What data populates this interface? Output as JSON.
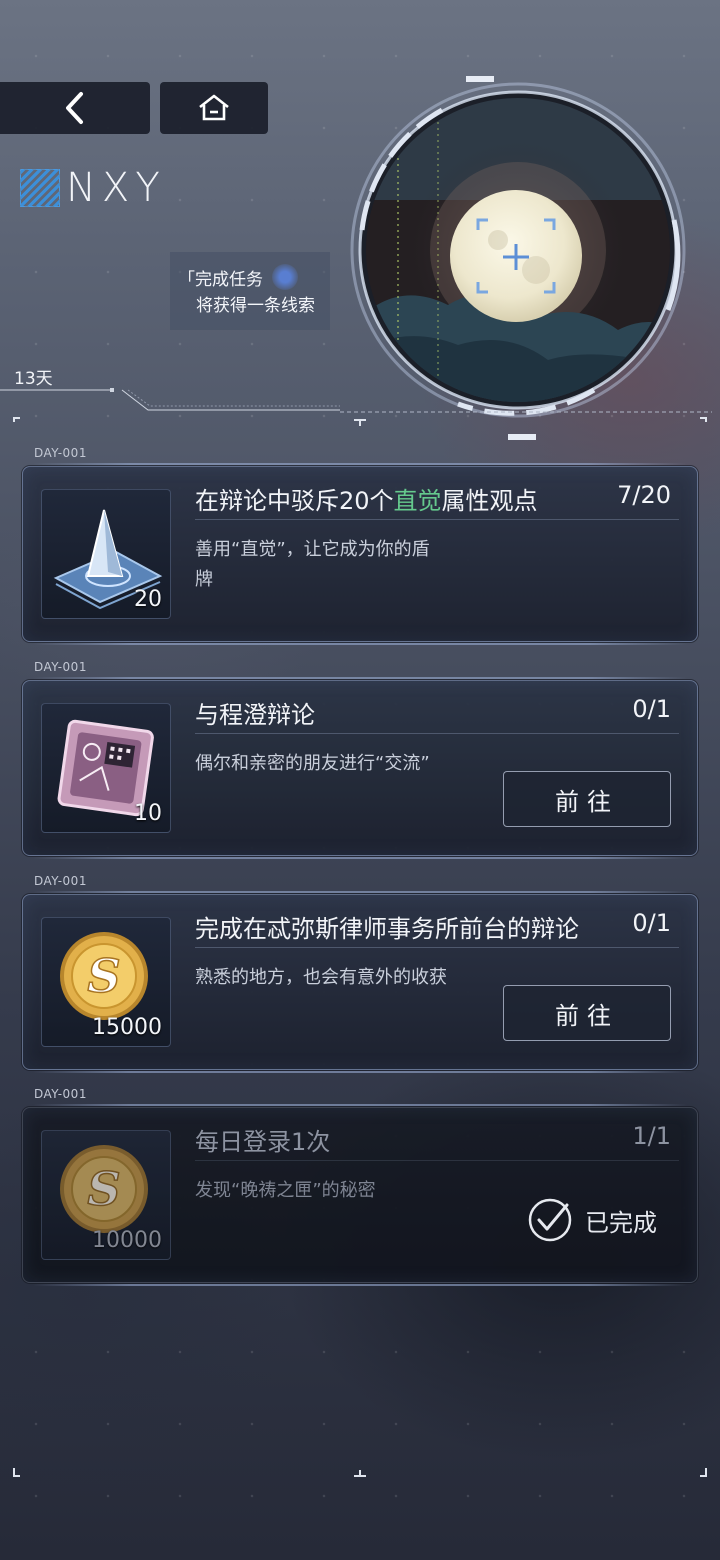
{
  "nav": {
    "back_icon": "chevron-left-icon",
    "home_icon": "home-icon"
  },
  "logo": {
    "text": "NXY"
  },
  "clue_notice": {
    "line1": "「完成任务",
    "line2": "将获得一条线索"
  },
  "days_remaining": "13天",
  "tasks": [
    {
      "day": "DAY-001",
      "title_pre": "在辩论中驳斥20个",
      "title_highlight": "直觉",
      "title_post": "属性观点",
      "progress": "7/20",
      "desc_line1": "善用“直觉”，让它成为你的盾",
      "desc_line2": "牌",
      "reward_icon": "prism-card-icon",
      "reward_count": "20",
      "status": "in_progress"
    },
    {
      "day": "DAY-001",
      "title": "与程澄辩论",
      "progress": "0/1",
      "desc_line1": "偶尔和亲密的朋友进行“交流”",
      "reward_icon": "memory-chip-icon",
      "reward_count": "10",
      "button_label": "前往",
      "status": "available"
    },
    {
      "day": "DAY-001",
      "title": "完成在忒弥斯律师事务所前台的辩论",
      "progress": "0/1",
      "desc_line1": "熟悉的地方，也会有意外的收获",
      "reward_icon": "gold-coin-icon",
      "reward_count": "15000",
      "button_label": "前往",
      "status": "available"
    },
    {
      "day": "DAY-001",
      "title": "每日登录1次",
      "progress": "1/1",
      "desc_line1": "发现“晚祷之匣”的秘密",
      "reward_icon": "gold-coin-icon",
      "reward_count": "10000",
      "done_label": "已完成",
      "status": "completed"
    }
  ],
  "colors": {
    "highlight_green": "#65c98d",
    "logo_blue": "#3c8fd9"
  }
}
